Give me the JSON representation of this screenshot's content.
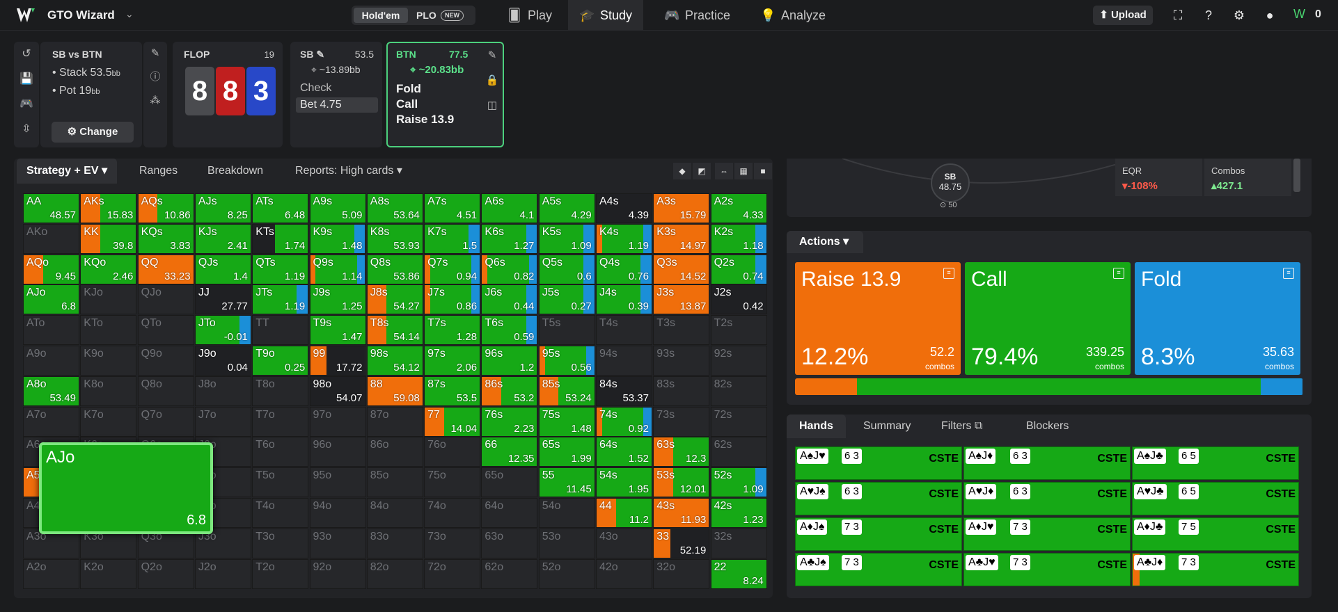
{
  "header": {
    "brand": "GTO Wizard",
    "game_holdem": "Hold'em",
    "game_plo": "PLO",
    "new_badge": "NEW",
    "nav": [
      {
        "label": "Play"
      },
      {
        "label": "Study"
      },
      {
        "label": "Practice"
      },
      {
        "label": "Analyze"
      }
    ],
    "upload": "Upload",
    "coins": "0"
  },
  "spot": {
    "title": "SB vs BTN",
    "stack": "• Stack 53.5",
    "pot": "• Pot 19",
    "bb_unit": "bb",
    "change": "Change",
    "flop_label": "FLOP",
    "flop_pot": "19",
    "board": [
      "8",
      "8",
      "3"
    ],
    "sb_name": "SB",
    "sb_stack": "53.5",
    "sb_eq": "~13.89bb",
    "sb_actions": [
      "Check",
      "Bet 4.75"
    ],
    "btn_name": "BTN",
    "btn_stack": "77.5",
    "btn_eq": "~20.83bb",
    "btn_actions": [
      "Fold",
      "Call",
      "Raise 13.9"
    ]
  },
  "grid_tabs": [
    "Strategy + EV",
    "Ranges",
    "Breakdown",
    "Reports: High cards"
  ],
  "colors": {
    "raise": "#f06e0b",
    "call": "#16a916",
    "fold": "#1b8fd8",
    "empty": "#26272a"
  },
  "grid": [
    [
      [
        "AA",
        "48.57",
        "c"
      ],
      [
        "AKs",
        "15.83",
        "rc"
      ],
      [
        "AQs",
        "10.86",
        "rc"
      ],
      [
        "AJs",
        "8.25",
        "c"
      ],
      [
        "ATs",
        "6.48",
        "c"
      ],
      [
        "A9s",
        "5.09",
        "c"
      ],
      [
        "A8s",
        "53.64",
        "c"
      ],
      [
        "A7s",
        "4.51",
        "c"
      ],
      [
        "A6s",
        "4.1",
        "c"
      ],
      [
        "A5s",
        "4.29",
        "c"
      ],
      [
        "A4s",
        "4.39",
        "x"
      ],
      [
        "A3s",
        "15.79",
        "r"
      ],
      [
        "A2s",
        "4.33",
        "c"
      ]
    ],
    [
      [
        "AKo",
        "",
        ""
      ],
      [
        "KK",
        "39.8",
        "rc"
      ],
      [
        "KQs",
        "3.83",
        "c"
      ],
      [
        "KJs",
        "2.41",
        "c"
      ],
      [
        "KTs",
        "1.74",
        "xc"
      ],
      [
        "K9s",
        "1.48",
        "cf"
      ],
      [
        "K8s",
        "53.93",
        "c"
      ],
      [
        "K7s",
        "1.5",
        "cf"
      ],
      [
        "K6s",
        "1.27",
        "cf"
      ],
      [
        "K5s",
        "1.09",
        "cf"
      ],
      [
        "K4s",
        "1.19",
        "rcf"
      ],
      [
        "K3s",
        "14.97",
        "r"
      ],
      [
        "K2s",
        "1.18",
        "cf"
      ]
    ],
    [
      [
        "AQo",
        "9.45",
        "rc"
      ],
      [
        "KQo",
        "2.46",
        "c"
      ],
      [
        "QQ",
        "33.23",
        "r"
      ],
      [
        "QJs",
        "1.4",
        "c"
      ],
      [
        "QTs",
        "1.19",
        "c"
      ],
      [
        "Q9s",
        "1.14",
        "rcf"
      ],
      [
        "Q8s",
        "53.86",
        "c"
      ],
      [
        "Q7s",
        "0.94",
        "rcf"
      ],
      [
        "Q6s",
        "0.82",
        "rcf"
      ],
      [
        "Q5s",
        "0.6",
        "cf"
      ],
      [
        "Q4s",
        "0.76",
        "cf"
      ],
      [
        "Q3s",
        "14.52",
        "r"
      ],
      [
        "Q2s",
        "0.74",
        "cf"
      ]
    ],
    [
      [
        "AJo",
        "6.8",
        "c"
      ],
      [
        "KJo",
        "",
        ""
      ],
      [
        "QJo",
        "",
        ""
      ],
      [
        "JJ",
        "27.77",
        "x"
      ],
      [
        "JTs",
        "1.19",
        "cf"
      ],
      [
        "J9s",
        "1.25",
        "c"
      ],
      [
        "J8s",
        "54.27",
        "rc"
      ],
      [
        "J7s",
        "0.86",
        "rcf"
      ],
      [
        "J6s",
        "0.44",
        "cf"
      ],
      [
        "J5s",
        "0.27",
        "cf"
      ],
      [
        "J4s",
        "0.39",
        "cf"
      ],
      [
        "J3s",
        "13.87",
        "r"
      ],
      [
        "J2s",
        "0.42",
        "x"
      ]
    ],
    [
      [
        "ATo",
        "",
        ""
      ],
      [
        "KTo",
        "",
        ""
      ],
      [
        "QTo",
        "",
        ""
      ],
      [
        "JTo",
        "-0.01",
        "cf"
      ],
      [
        "TT",
        "",
        ""
      ],
      [
        "T9s",
        "1.47",
        "c"
      ],
      [
        "T8s",
        "54.14",
        "rc"
      ],
      [
        "T7s",
        "1.28",
        "c"
      ],
      [
        "T6s",
        "0.59",
        "cf"
      ],
      [
        "T5s",
        "",
        ""
      ],
      [
        "T4s",
        "",
        ""
      ],
      [
        "T3s",
        "",
        ""
      ],
      [
        "T2s",
        "",
        ""
      ]
    ],
    [
      [
        "A9o",
        "",
        ""
      ],
      [
        "K9o",
        "",
        ""
      ],
      [
        "Q9o",
        "",
        ""
      ],
      [
        "J9o",
        "0.04",
        "x"
      ],
      [
        "T9o",
        "0.25",
        "c"
      ],
      [
        "99",
        "17.72",
        "rx"
      ],
      [
        "98s",
        "54.12",
        "c"
      ],
      [
        "97s",
        "2.06",
        "c"
      ],
      [
        "96s",
        "1.2",
        "c"
      ],
      [
        "95s",
        "0.56",
        "rcf"
      ],
      [
        "94s",
        "",
        ""
      ],
      [
        "93s",
        "",
        ""
      ],
      [
        "92s",
        "",
        ""
      ]
    ],
    [
      [
        "A8o",
        "53.49",
        "c"
      ],
      [
        "K8o",
        "",
        ""
      ],
      [
        "Q8o",
        "",
        ""
      ],
      [
        "J8o",
        "",
        ""
      ],
      [
        "T8o",
        "",
        ""
      ],
      [
        "98o",
        "54.07",
        "x"
      ],
      [
        "88",
        "59.08",
        "r"
      ],
      [
        "87s",
        "53.5",
        "c"
      ],
      [
        "86s",
        "53.2",
        "rc"
      ],
      [
        "85s",
        "53.24",
        "rc"
      ],
      [
        "84s",
        "53.37",
        "x"
      ],
      [
        "83s",
        "",
        ""
      ],
      [
        "82s",
        "",
        ""
      ]
    ],
    [
      [
        "A7o",
        "",
        ""
      ],
      [
        "K7o",
        "",
        ""
      ],
      [
        "Q7o",
        "",
        ""
      ],
      [
        "J7o",
        "",
        ""
      ],
      [
        "T7o",
        "",
        ""
      ],
      [
        "97o",
        "",
        ""
      ],
      [
        "87o",
        "",
        ""
      ],
      [
        "77",
        "14.04",
        "rc"
      ],
      [
        "76s",
        "2.23",
        "c"
      ],
      [
        "75s",
        "1.48",
        "c"
      ],
      [
        "74s",
        "0.92",
        "rcf"
      ],
      [
        "73s",
        "",
        ""
      ],
      [
        "72s",
        "",
        ""
      ]
    ],
    [
      [
        "A6o",
        "",
        ""
      ],
      [
        "K6o",
        "",
        ""
      ],
      [
        "Q6o",
        "",
        ""
      ],
      [
        "J6o",
        "",
        ""
      ],
      [
        "T6o",
        "",
        ""
      ],
      [
        "96o",
        "",
        ""
      ],
      [
        "86o",
        "",
        ""
      ],
      [
        "76o",
        "",
        ""
      ],
      [
        "66",
        "12.35",
        "c"
      ],
      [
        "65s",
        "1.99",
        "c"
      ],
      [
        "64s",
        "1.52",
        "c"
      ],
      [
        "63s",
        "12.3",
        "rc"
      ],
      [
        "62s",
        "",
        ""
      ]
    ],
    [
      [
        "A5o",
        "2.81",
        "rc"
      ],
      [
        "K5o",
        "",
        ""
      ],
      [
        "Q5o",
        "",
        ""
      ],
      [
        "J5o",
        "",
        ""
      ],
      [
        "T5o",
        "",
        ""
      ],
      [
        "95o",
        "",
        ""
      ],
      [
        "85o",
        "",
        ""
      ],
      [
        "75o",
        "",
        ""
      ],
      [
        "65o",
        "",
        ""
      ],
      [
        "55",
        "11.45",
        "c"
      ],
      [
        "54s",
        "1.95",
        "c"
      ],
      [
        "53s",
        "12.01",
        "rc"
      ],
      [
        "52s",
        "1.09",
        "cf"
      ]
    ],
    [
      [
        "A4o",
        "",
        ""
      ],
      [
        "K4o",
        "",
        ""
      ],
      [
        "Q4o",
        "",
        ""
      ],
      [
        "J4o",
        "",
        ""
      ],
      [
        "T4o",
        "",
        ""
      ],
      [
        "94o",
        "",
        ""
      ],
      [
        "84o",
        "",
        ""
      ],
      [
        "74o",
        "",
        ""
      ],
      [
        "64o",
        "",
        ""
      ],
      [
        "54o",
        "",
        ""
      ],
      [
        "44",
        "11.2",
        "rc"
      ],
      [
        "43s",
        "11.93",
        "r"
      ],
      [
        "42s",
        "1.23",
        "c"
      ]
    ],
    [
      [
        "A3o",
        "",
        ""
      ],
      [
        "K3o",
        "",
        ""
      ],
      [
        "Q3o",
        "",
        ""
      ],
      [
        "J3o",
        "",
        ""
      ],
      [
        "T3o",
        "",
        ""
      ],
      [
        "93o",
        "",
        ""
      ],
      [
        "83o",
        "",
        ""
      ],
      [
        "73o",
        "",
        ""
      ],
      [
        "63o",
        "",
        ""
      ],
      [
        "53o",
        "",
        ""
      ],
      [
        "43o",
        "",
        ""
      ],
      [
        "33",
        "52.19",
        "rx"
      ],
      [
        "32s",
        "",
        ""
      ]
    ],
    [
      [
        "A2o",
        "",
        ""
      ],
      [
        "K2o",
        "",
        ""
      ],
      [
        "Q2o",
        "",
        ""
      ],
      [
        "J2o",
        "",
        ""
      ],
      [
        "T2o",
        "",
        ""
      ],
      [
        "92o",
        "",
        ""
      ],
      [
        "82o",
        "",
        ""
      ],
      [
        "72o",
        "",
        ""
      ],
      [
        "62o",
        "",
        ""
      ],
      [
        "52o",
        "",
        ""
      ],
      [
        "42o",
        "",
        ""
      ],
      [
        "32o",
        "",
        ""
      ],
      [
        "22",
        "8.24",
        "c"
      ]
    ]
  ],
  "selected_hand": {
    "hand": "AJo",
    "ev": "6.8"
  },
  "table": {
    "seat_name": "SB",
    "seat_stack": "48.75",
    "seat_bet": "50",
    "eqr_label": "EQR",
    "eqr_value": "-108%",
    "combos_label": "Combos",
    "combos_value": "427.1"
  },
  "actions": {
    "tab": "Actions",
    "items": [
      {
        "label": "Raise 13.9",
        "pct": "12.2%",
        "combos": "52.2",
        "combos_label": "combos",
        "freq": 12.2
      },
      {
        "label": "Call",
        "pct": "79.4%",
        "combos": "339.25",
        "combos_label": "combos",
        "freq": 79.4
      },
      {
        "label": "Fold",
        "pct": "8.3%",
        "combos": "35.63",
        "combos_label": "combos",
        "freq": 8.3
      }
    ]
  },
  "hands_tabs": [
    "Hands",
    "Summary",
    "Filters",
    "Blockers"
  ],
  "hands": [
    [
      {
        "cards": "A♠J♥",
        "board": "6 3"
      },
      {
        "cards": "A♠J♦",
        "board": "6 3"
      },
      {
        "cards": "A♠J♣",
        "board": "6 5"
      }
    ],
    [
      {
        "cards": "A♥J♠",
        "board": "6 3"
      },
      {
        "cards": "A♥J♦",
        "board": "6 3"
      },
      {
        "cards": "A♥J♣",
        "board": "6 5"
      }
    ],
    [
      {
        "cards": "A♦J♠",
        "board": "7 3"
      },
      {
        "cards": "A♦J♥",
        "board": "7 3"
      },
      {
        "cards": "A♦J♣",
        "board": "7 5"
      }
    ],
    [
      {
        "cards": "A♣J♠",
        "board": "7 3"
      },
      {
        "cards": "A♣J♥",
        "board": "7 3"
      },
      {
        "cards": "A♣J♦",
        "board": "7 3"
      }
    ]
  ],
  "hand_tag": "CSTE"
}
